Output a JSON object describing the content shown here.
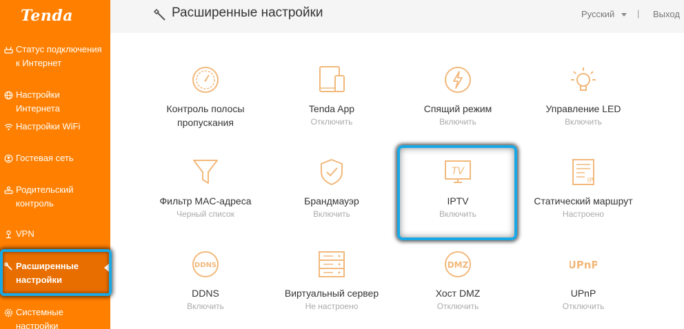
{
  "sidebar": {
    "logo": "Tenda",
    "items": [
      {
        "label": "Статус подключения к Интернет",
        "icon": "router-icon"
      },
      {
        "label": "Настройки Интернета",
        "icon": "globe-icon"
      },
      {
        "label": "Настройки WiFi",
        "icon": "wifi-icon"
      },
      {
        "label": "Гостевая сеть",
        "icon": "guest-icon"
      },
      {
        "label": "Родительский контроль",
        "icon": "parental-icon"
      },
      {
        "label": "VPN",
        "icon": "vpn-icon"
      },
      {
        "label": "Расширенные настройки",
        "icon": "wrench-icon",
        "active": true
      },
      {
        "label": "Системные настройки",
        "icon": "gear-icon"
      }
    ]
  },
  "header": {
    "title": "Расширенные настройки",
    "language": "Русский",
    "separator": "|",
    "logout": "Выход"
  },
  "tiles": [
    {
      "name": "Контроль полосы пропускания",
      "status": "",
      "icon": "speedometer-icon"
    },
    {
      "name": "Tenda App",
      "status": "Отключить",
      "icon": "tablet-phone-icon"
    },
    {
      "name": "Спящий режим",
      "status": "Включить",
      "icon": "sleep-lightning-icon"
    },
    {
      "name": "Управление LED",
      "status": "Включить",
      "icon": "led-bulb-icon"
    },
    {
      "name": "Фильтр MAC-адреса",
      "status": "Черный список",
      "icon": "funnel-icon"
    },
    {
      "name": "Брандмауэр",
      "status": "Включить",
      "icon": "shield-check-icon"
    },
    {
      "name": "IPTV",
      "status": "Включить",
      "icon": "tv-icon"
    },
    {
      "name": "Статический маршрут",
      "status": "Настроено",
      "icon": "route-list-icon"
    },
    {
      "name": "DDNS",
      "status": "Включить",
      "icon": "ddns-icon"
    },
    {
      "name": "Виртуальный сервер",
      "status": "Не настроено",
      "icon": "server-rack-icon"
    },
    {
      "name": "Хост DMZ",
      "status": "Отключить",
      "icon": "dmz-icon"
    },
    {
      "name": "UPnP",
      "status": "Отключить",
      "icon": "upnp-icon"
    }
  ],
  "tile_icon_text": {
    "tv": "TV",
    "ip": "IP",
    "ddns": "DDNS",
    "dmz": "DMZ",
    "upnp": "UPnP"
  },
  "colors": {
    "brand": "#ff7f00",
    "icon": "#f2b87a",
    "highlight": "#19a8e6"
  }
}
